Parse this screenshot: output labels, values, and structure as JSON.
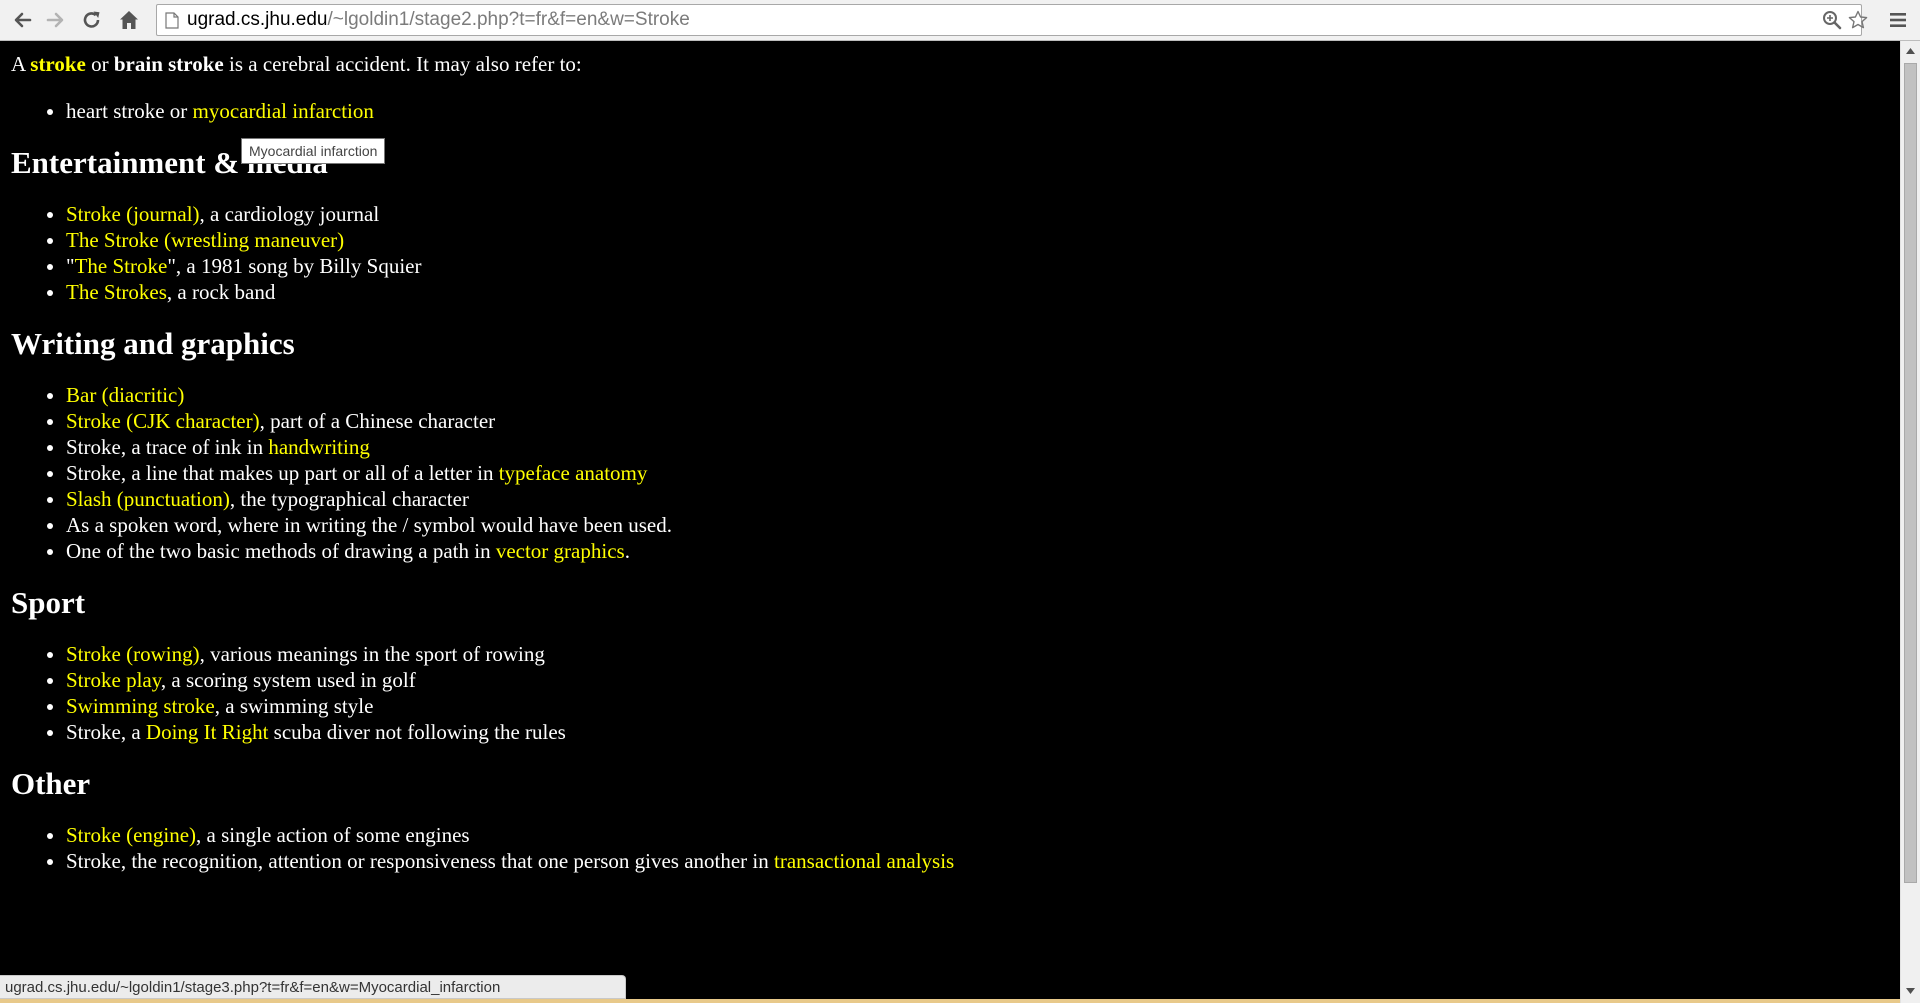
{
  "browser": {
    "url_host": "ugrad.cs.jhu.edu",
    "url_path": "/~lgoldin1/stage2.php?t=fr&f=en&w=Stroke",
    "status_url": "ugrad.cs.jhu.edu/~lgoldin1/stage3.php?t=fr&f=en&w=Myocardial_infarction",
    "tooltip": "Myocardial infarction",
    "icons": [
      "back-icon",
      "forward-icon",
      "reload-icon",
      "home-icon",
      "page-icon",
      "zoom-icon",
      "star-icon",
      "menu-icon"
    ]
  },
  "colors": {
    "background": "#000000",
    "text": "#ffffff",
    "link": "#ffff00"
  },
  "intro": {
    "t1": "A ",
    "link1": "stroke",
    "t2": " or ",
    "bold1": "brain stroke",
    "t3": " is a cerebral accident. It may also refer to:"
  },
  "intro_list": [
    {
      "t1": "heart stroke or ",
      "link": "myocardial infarction"
    }
  ],
  "sections": {
    "entertainment": {
      "heading": "Entertainment & media",
      "items": [
        {
          "link": "Stroke (journal)",
          "text": ", a cardiology journal"
        },
        {
          "link": "The Stroke (wrestling maneuver)"
        },
        {
          "pre": "\"",
          "link": "The Stroke",
          "text": "\", a 1981 song by Billy Squier"
        },
        {
          "link": "The Strokes",
          "text": ", a rock band"
        }
      ]
    },
    "writing": {
      "heading": "Writing and graphics",
      "items": [
        {
          "link": "Bar (diacritic)"
        },
        {
          "link": "Stroke (CJK character)",
          "text": ", part of a Chinese character"
        },
        {
          "pre": "Stroke, a trace of ink in ",
          "link": "handwriting"
        },
        {
          "pre": "Stroke, a line that makes up part or all of a letter in ",
          "link": "typeface anatomy"
        },
        {
          "link": "Slash (punctuation)",
          "text": ", the typographical character"
        },
        {
          "pre": "As a spoken word, where in writing the / symbol would have been used."
        },
        {
          "pre": "One of the two basic methods of drawing a path in ",
          "link": "vector graphics",
          "text": "."
        }
      ]
    },
    "sport": {
      "heading": "Sport",
      "items": [
        {
          "link": "Stroke (rowing)",
          "text": ", various meanings in the sport of rowing"
        },
        {
          "link": "Stroke play",
          "text": ", a scoring system used in golf"
        },
        {
          "link": "Swimming stroke",
          "text": ", a swimming style"
        },
        {
          "pre": "Stroke, a ",
          "link": "Doing It Right",
          "text": " scuba diver not following the rules"
        }
      ]
    },
    "other": {
      "heading": "Other",
      "items": [
        {
          "link": "Stroke (engine)",
          "text": ", a single action of some engines"
        },
        {
          "pre": "Stroke, the recognition, attention or responsiveness that one person gives another in ",
          "link": "transactional analysis"
        }
      ]
    }
  }
}
